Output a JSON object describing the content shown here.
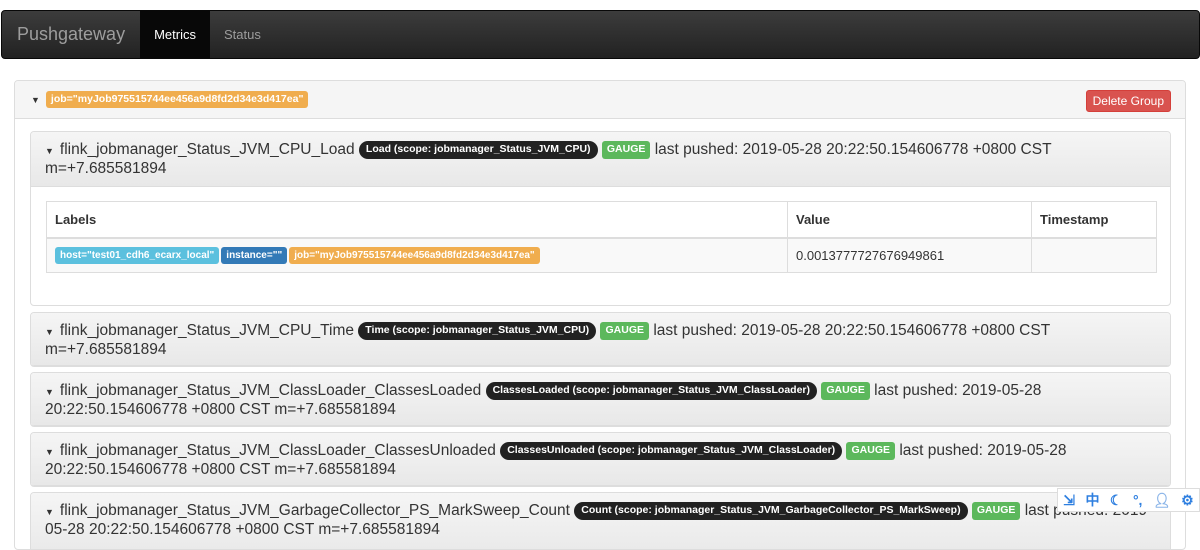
{
  "navbar": {
    "brand": "Pushgateway",
    "items": [
      {
        "label": "Metrics",
        "active": true
      },
      {
        "label": "Status",
        "active": false
      }
    ]
  },
  "group": {
    "job_label": "job=\"myJob975515744ee456a9d8fd2d34e3d417ea\"",
    "delete_button": "Delete Group"
  },
  "table": {
    "headers": [
      "Labels",
      "Value",
      "Timestamp"
    ],
    "row": {
      "labels": [
        "host=\"test01_cdh6_ecarx_local\"",
        "instance=\"\"",
        "job=\"myJob975515744ee456a9d8fd2d34e3d417ea\""
      ],
      "value": "0.0013777727676949861",
      "timestamp": ""
    }
  },
  "metrics": [
    {
      "name": "flink_jobmanager_Status_JVM_CPU_Load",
      "help": "Load (scope: jobmanager_Status_JVM_CPU)",
      "type": "GAUGE",
      "pushed": "last pushed: 2019-05-28 20:22:50.154606778 +0800 CST m=+7.685581894"
    },
    {
      "name": "flink_jobmanager_Status_JVM_CPU_Time",
      "help": "Time (scope: jobmanager_Status_JVM_CPU)",
      "type": "GAUGE",
      "pushed": "last pushed: 2019-05-28 20:22:50.154606778 +0800 CST m=+7.685581894"
    },
    {
      "name": "flink_jobmanager_Status_JVM_ClassLoader_ClassesLoaded",
      "help": "ClassesLoaded (scope: jobmanager_Status_JVM_ClassLoader)",
      "type": "GAUGE",
      "pushed": "last pushed: 2019-05-28 20:22:50.154606778 +0800 CST m=+7.685581894"
    },
    {
      "name": "flink_jobmanager_Status_JVM_ClassLoader_ClassesUnloaded",
      "help": "ClassesUnloaded (scope: jobmanager_Status_JVM_ClassLoader)",
      "type": "GAUGE",
      "pushed": "last pushed: 2019-05-28 20:22:50.154606778 +0800 CST m=+7.685581894"
    },
    {
      "name": "flink_jobmanager_Status_JVM_GarbageCollector_PS_MarkSweep_Count",
      "help": "Count (scope: jobmanager_Status_JVM_GarbageCollector_PS_MarkSweep)",
      "type": "GAUGE",
      "pushed": "last pushed: 2019-05-28 20:22:50.154606778 +0800 CST m=+7.685581894"
    }
  ],
  "ime_toolbar": {
    "items": [
      "中"
    ]
  },
  "colors": {
    "warning": "#f0ad4e",
    "info": "#5bc0de",
    "primary": "#337ab7",
    "success": "#5cb85c",
    "danger": "#d9534f"
  }
}
